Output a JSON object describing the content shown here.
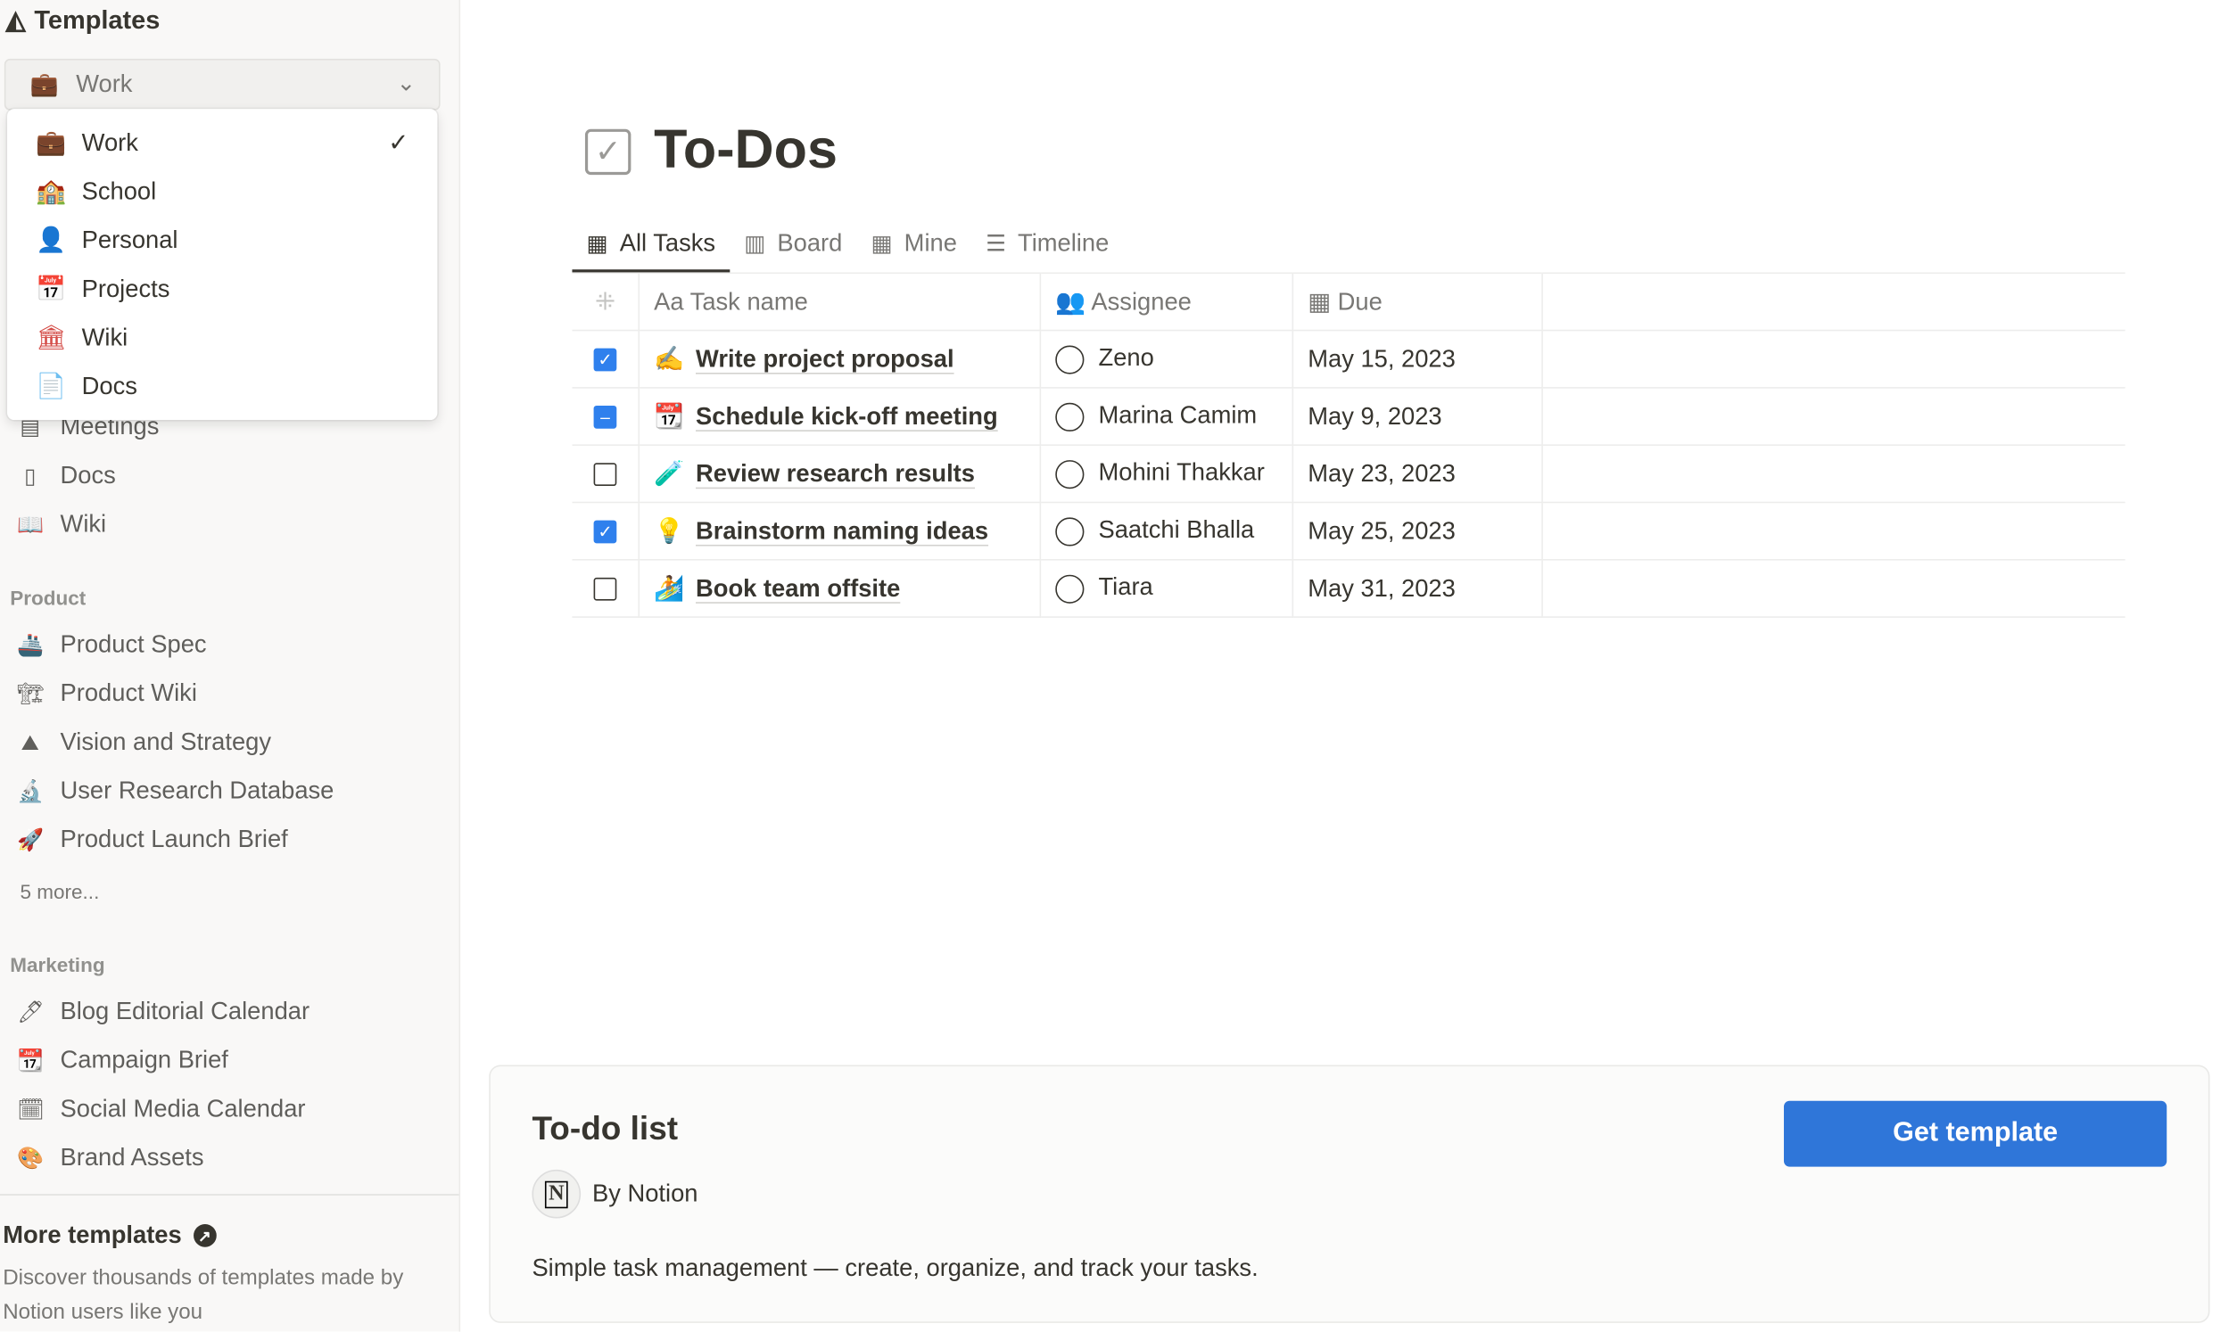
{
  "sidebar": {
    "title": "Templates",
    "category_select": {
      "value": "Work"
    },
    "menu": [
      {
        "label": "Work",
        "icon": "briefcase-icon",
        "color": "#d9730d",
        "selected": true
      },
      {
        "label": "School",
        "icon": "school-icon",
        "color": "#9065b0"
      },
      {
        "label": "Personal",
        "icon": "person-icon",
        "color": "#448361"
      },
      {
        "label": "Projects",
        "icon": "calendar-icon",
        "color": "#337ea9"
      },
      {
        "label": "Wiki",
        "icon": "building-columns-icon",
        "color": "#d44c47"
      },
      {
        "label": "Docs",
        "icon": "document-icon",
        "color": "#cb912f"
      }
    ],
    "items_top": [
      {
        "label": "Meetings"
      },
      {
        "label": "Docs"
      },
      {
        "label": "Wiki"
      }
    ],
    "product": {
      "heading": "Product",
      "items": [
        {
          "label": "Product Spec"
        },
        {
          "label": "Product Wiki"
        },
        {
          "label": "Vision and Strategy"
        },
        {
          "label": "User Research Database"
        },
        {
          "label": "Product Launch Brief"
        }
      ],
      "more": "5 more..."
    },
    "marketing": {
      "heading": "Marketing",
      "items": [
        {
          "label": "Blog Editorial Calendar"
        },
        {
          "label": "Campaign Brief"
        },
        {
          "label": "Social Media Calendar"
        },
        {
          "label": "Brand Assets"
        }
      ]
    },
    "more_templates": {
      "title": "More templates",
      "desc": "Discover thousands of templates made by Notion users like you"
    }
  },
  "page": {
    "title": "To-Dos",
    "tabs": [
      {
        "label": "All Tasks",
        "active": true
      },
      {
        "label": "Board"
      },
      {
        "label": "Mine"
      },
      {
        "label": "Timeline"
      }
    ],
    "columns": {
      "name": "Task name",
      "name_prefix": "Aa",
      "assignee": "Assignee",
      "due": "Due"
    },
    "rows": [
      {
        "state": "checked",
        "emoji": "✍️",
        "task": "Write project proposal",
        "assignee": "Zeno",
        "due": "May 15, 2023"
      },
      {
        "state": "indeterminate",
        "emoji": "📆",
        "task": "Schedule kick-off meeting",
        "assignee": "Marina Camim",
        "due": "May 9, 2023"
      },
      {
        "state": "unchecked",
        "emoji": "🧪",
        "task": "Review research results",
        "assignee": "Mohini Thakkar",
        "due": "May 23, 2023"
      },
      {
        "state": "checked",
        "emoji": "💡",
        "task": "Brainstorm naming ideas",
        "assignee": "Saatchi Bhalla",
        "due": "May 25, 2023"
      },
      {
        "state": "unchecked",
        "emoji": "🏄",
        "task": "Book team offsite",
        "assignee": "Tiara",
        "due": "May 31, 2023"
      }
    ]
  },
  "card": {
    "title": "To-do list",
    "author": "By Notion",
    "description": "Simple task management — create, organize, and track your tasks.",
    "button": "Get template",
    "accent": "#2f76d9"
  }
}
